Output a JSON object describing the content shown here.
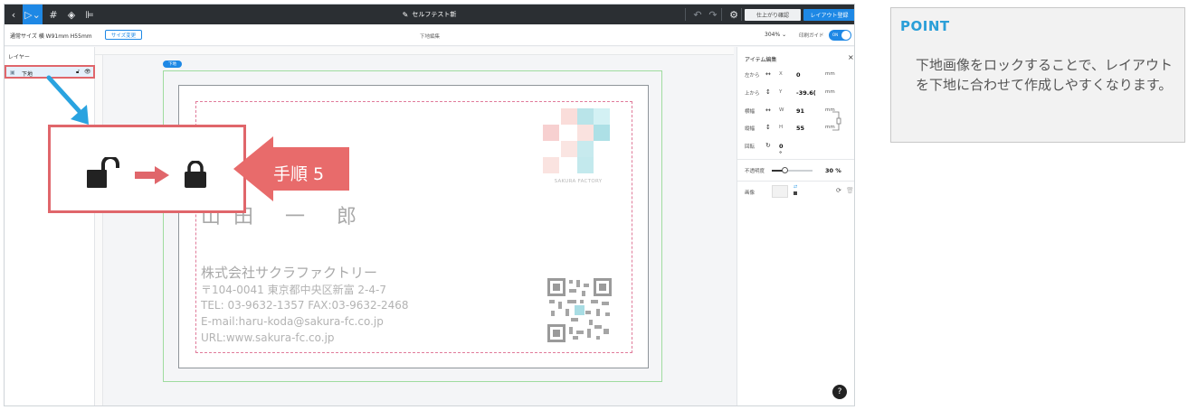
{
  "toolbar": {
    "title": "セルフテスト新",
    "confirm_label": "仕上がり確認",
    "register_label": "レイアウト登録"
  },
  "subbar": {
    "size_label": "通常サイズ 横 W91mm H55mm",
    "size_change_label": "サイズ変更",
    "mode_label": "下地編集",
    "zoom": "304%",
    "print_guide_label": "印刷ガイド",
    "toggle_label": "ON"
  },
  "layers": {
    "title": "レイヤー",
    "items": [
      {
        "name": "下地"
      }
    ]
  },
  "canvas": {
    "page_tag": "下地"
  },
  "card": {
    "logo_text": "SAKURA FACTORY",
    "name": "山田 一 郎",
    "company": "株式会社サクラファクトリー",
    "info_lines": [
      "〒104-0041 東京都中央区新富 2-4-7",
      "TEL: 03-9632-1357   FAX:03-9632-2468",
      "E-mail:haru-koda@sakura-fc.co.jp",
      "URL:www.sakura-fc.co.jp"
    ]
  },
  "item_panel": {
    "title": "アイテム編集",
    "rows": [
      {
        "label": "左から",
        "axis": "X",
        "value": "0",
        "unit": "mm"
      },
      {
        "label": "上から",
        "axis": "Y",
        "value": "-39.6(",
        "unit": "mm"
      },
      {
        "label": "横幅",
        "axis": "W",
        "value": "91",
        "unit": "mm"
      },
      {
        "label": "縦幅",
        "axis": "H",
        "value": "55",
        "unit": "mm"
      }
    ],
    "rotation_label": "回転",
    "rotation_value": "0 °",
    "opacity_label": "不透明度",
    "opacity_value": "30 %",
    "opacity_level": 0.3,
    "image_label": "画像"
  },
  "annotation": {
    "step_label": "手順 5"
  },
  "point": {
    "title": "POINT",
    "text": "下地画像をロックすることで、レイアウトを下地に合わせて作成しやすくなります。"
  },
  "colors": {
    "accent": "#1e88e5",
    "highlight": "#e0666b",
    "point_title": "#2a9fd8"
  },
  "help_label": "?"
}
